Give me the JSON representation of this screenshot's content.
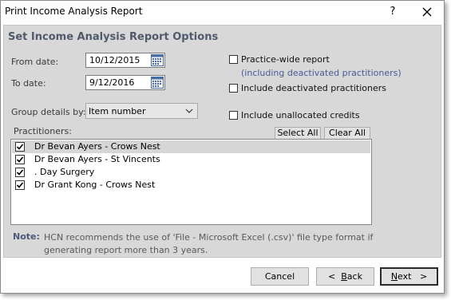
{
  "window": {
    "title": "Print Income Analysis Report",
    "help": "?",
    "close": "✕"
  },
  "options": {
    "heading": "Set Income Analysis Report Options",
    "from_label": "From date:",
    "from_value": "10/12/2015",
    "to_label": "To date:",
    "to_value": "9/12/2016",
    "group_label": "Group details by:",
    "group_value": "Item number",
    "practice_wide": "Practice-wide report",
    "practice_wide_sub": "(including deactivated practitioners)",
    "include_deactivated": "Include deactivated practitioners",
    "include_unallocated": "Include unallocated credits",
    "practitioners_label": "Practitioners:",
    "select_all": "Select All",
    "clear_all": "Clear All"
  },
  "practitioners": [
    {
      "name": "Dr Bevan Ayers - Crows Nest",
      "checked": true
    },
    {
      "name": "Dr Bevan Ayers - St Vincents",
      "checked": true
    },
    {
      "name": ". Day Surgery",
      "checked": true
    },
    {
      "name": "Dr Grant Kong - Crows Nest",
      "checked": true
    }
  ],
  "note": {
    "label": "Note:",
    "text": "HCN recommends the use of 'File - Microsoft Excel (.csv)' file type format if generating report more than 3 years."
  },
  "footer": {
    "cancel": "Cancel",
    "back_prefix": "<",
    "back_hotkey": "B",
    "back_rest": "ack",
    "next_hotkey": "N",
    "next_rest": "ext",
    "next_suffix": ">"
  }
}
